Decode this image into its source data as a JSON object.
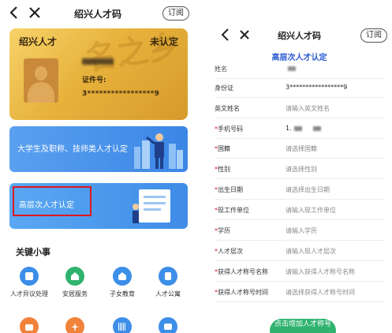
{
  "left": {
    "header": {
      "title": "绍兴人才码",
      "subscribe_label": "订阅"
    },
    "card": {
      "title": "绍兴人才",
      "status": "未认定",
      "id_label": "证件号:",
      "id_value": "3*****************9",
      "watermark": "名之乡"
    },
    "banners": [
      {
        "text": "大学生及职称、技师类人才认定"
      },
      {
        "text": "高层次人才认定"
      }
    ],
    "section_title": "关键小事",
    "services_row1": [
      {
        "label": "人才异议处理",
        "icon": "document-icon",
        "color": "#3d8ee8"
      },
      {
        "label": "安居服务",
        "icon": "home-icon",
        "color": "#2fb36e"
      },
      {
        "label": "子女教育",
        "icon": "school-icon",
        "color": "#3d8ee8"
      },
      {
        "label": "人才公寓",
        "icon": "building-icon",
        "color": "#3d8ee8"
      }
    ],
    "services_row2": [
      {
        "icon": "briefcase-icon",
        "color": "#f0823a"
      },
      {
        "icon": "airplane-icon",
        "color": "#f0823a"
      },
      {
        "icon": "barcode-icon",
        "color": "#3d8ee8"
      },
      {
        "icon": "book-icon",
        "color": "#3d8ee8"
      }
    ]
  },
  "right": {
    "header": {
      "title": "绍兴人才码",
      "subscribe_label": "订阅"
    },
    "form_title": "高层次人才认定",
    "fields": [
      {
        "label": "姓名",
        "required": false,
        "value": ""
      },
      {
        "label": "身份证",
        "required": false,
        "value": "3*****************9"
      },
      {
        "label": "英文姓名",
        "required": false,
        "placeholder": "请输入英文姓名"
      },
      {
        "label": "手机号码",
        "required": true,
        "value": "1."
      },
      {
        "label": "国籍",
        "required": true,
        "placeholder": "请选择国籍"
      },
      {
        "label": "性别",
        "required": true,
        "placeholder": "请选择性别"
      },
      {
        "label": "出生日期",
        "required": true,
        "placeholder": "请选择出生日期"
      },
      {
        "label": "现工作单位",
        "required": true,
        "placeholder": "请输入现工作单位"
      },
      {
        "label": "学历",
        "required": true,
        "placeholder": "请输入学历"
      },
      {
        "label": "人才层次",
        "required": true,
        "placeholder": "请输入现人才层次"
      },
      {
        "label": "获得人才称号名称",
        "required": true,
        "placeholder": "请输入获得人才称号名称"
      },
      {
        "label": "获得人才称号时间",
        "required": true,
        "placeholder": "请选择获得人才称号时间"
      }
    ],
    "submit_label": "点击增加人才称号",
    "required_mark": "*"
  },
  "colors": {
    "accent_blue": "#2a5bd0",
    "gold": "#e7b23c",
    "highlight_red": "#e0161e",
    "green": "#2fb36e"
  }
}
